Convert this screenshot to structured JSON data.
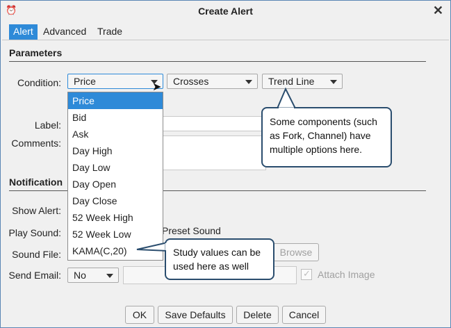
{
  "window": {
    "title": "Create Alert",
    "close_icon": "close-icon"
  },
  "tabs": [
    {
      "label": "Alert",
      "active": true
    },
    {
      "label": "Advanced",
      "active": false
    },
    {
      "label": "Trade",
      "active": false
    }
  ],
  "parameters": {
    "heading": "Parameters",
    "condition_label": "Condition:",
    "condition_value": "Price",
    "operator_value": "Crosses",
    "target_value": "Trend Line",
    "label_label": "Label:",
    "comments_label": "Comments:"
  },
  "dropdown_options": [
    "Price",
    "Bid",
    "Ask",
    "Day High",
    "Day Low",
    "Day Open",
    "Day Close",
    "52 Week High",
    "52 Week Low",
    "KAMA(C,20)"
  ],
  "notifications": {
    "heading": "Notification",
    "show_alert_label": "Show Alert:",
    "play_sound_label": "Play Sound:",
    "preset_sound_text": "Preset Sound",
    "sound_file_label": "Sound File:",
    "browse_label": "Browse",
    "send_email_label": "Send Email:",
    "send_email_value": "No",
    "attach_image_label": "Attach Image"
  },
  "callouts": {
    "components": "Some components (such as Fork, Channel) have multiple options here.",
    "study": "Study values can be used here as well"
  },
  "buttons": {
    "ok": "OK",
    "save_defaults": "Save Defaults",
    "delete": "Delete",
    "cancel": "Cancel"
  },
  "colors": {
    "accent": "#2e8ad8",
    "callout_border": "#2a4d6e",
    "frame_border": "#5a86b4"
  }
}
